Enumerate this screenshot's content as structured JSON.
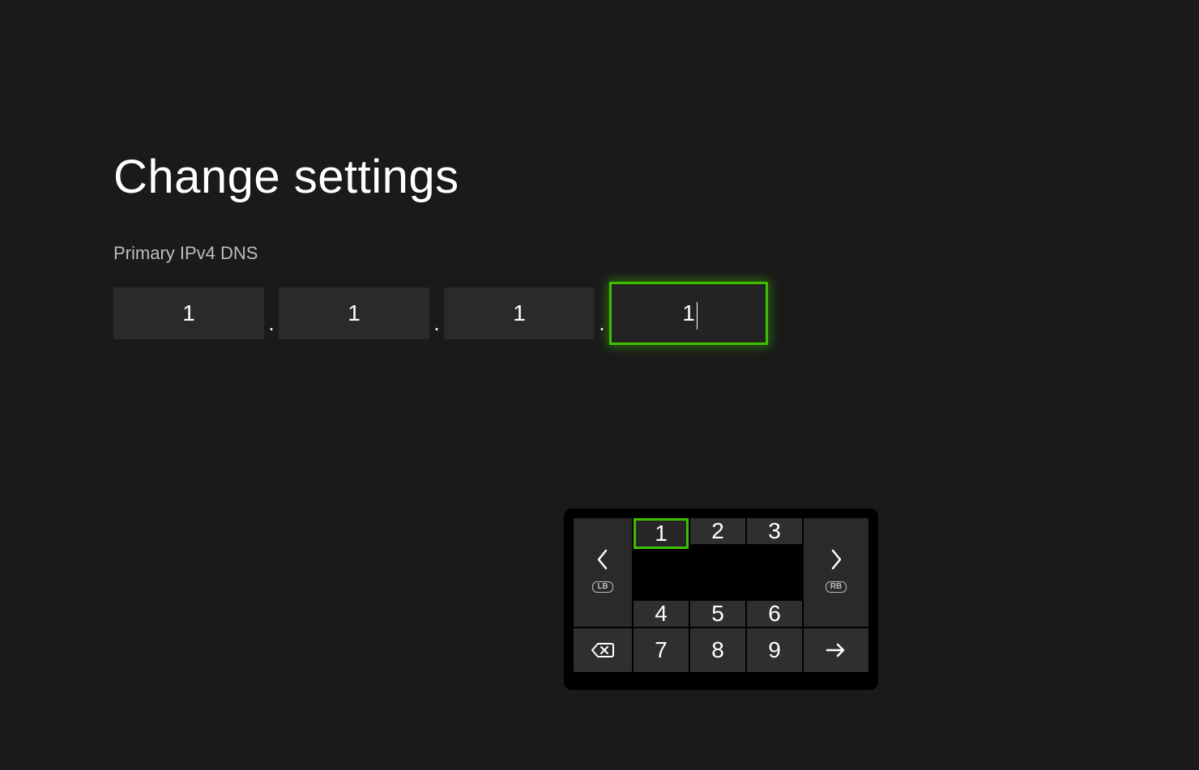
{
  "title": "Change settings",
  "field_label": "Primary IPv4 DNS",
  "ip": {
    "octets": [
      "1",
      "1",
      "1",
      "1"
    ],
    "selected_index": 3
  },
  "keypad": {
    "left_badge": "LB",
    "right_badge": "RB",
    "keys": [
      "1",
      "2",
      "3",
      "4",
      "5",
      "6",
      "7",
      "8",
      "9"
    ],
    "selected_key": "1"
  }
}
